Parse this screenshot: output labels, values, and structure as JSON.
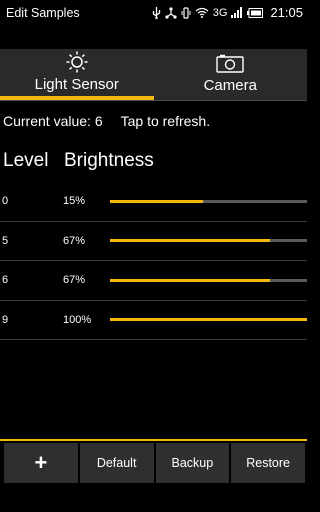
{
  "status_bar": {
    "app_title": "Edit Samples",
    "network": "3G",
    "time": "21:05",
    "icons": [
      "usb-icon",
      "share-icon",
      "vibrate-icon",
      "wifi-icon",
      "signal-icon",
      "battery-icon"
    ]
  },
  "tabs": [
    {
      "label": "Light Sensor",
      "icon": "sun-icon",
      "active": true
    },
    {
      "label": "Camera",
      "icon": "camera-icon",
      "active": false
    }
  ],
  "status": {
    "current_value": "Current value: 6",
    "refresh_hint": "Tap to refresh."
  },
  "table": {
    "headers": {
      "level": "Level",
      "brightness": "Brightness"
    },
    "rows": [
      {
        "level": "0",
        "brightness": "15%",
        "fraction": 0.47
      },
      {
        "level": "5",
        "brightness": "67%",
        "fraction": 0.81
      },
      {
        "level": "6",
        "brightness": "67%",
        "fraction": 0.81
      },
      {
        "level": "9",
        "brightness": "100%",
        "fraction": 1.0
      }
    ]
  },
  "buttons": {
    "add": "+",
    "default": "Default",
    "backup": "Backup",
    "restore": "Restore"
  },
  "colors": {
    "accent": "#f2b90c",
    "track": "#5a5a5a",
    "tabbar": "#2a2a2a",
    "button": "#2f2f2f"
  }
}
